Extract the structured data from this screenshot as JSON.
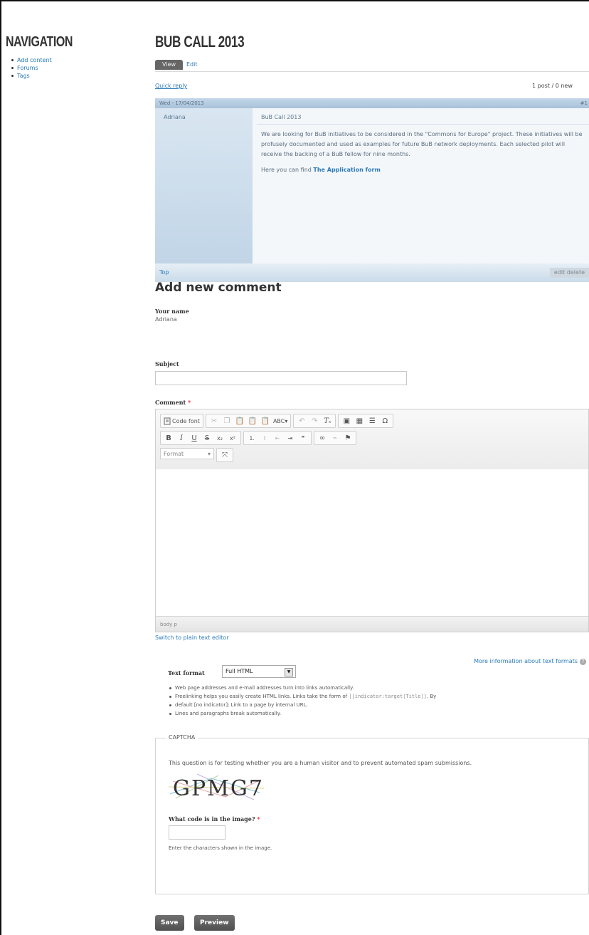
{
  "sidebar": {
    "title": "NAVIGATION",
    "items": [
      {
        "label": "Add content"
      },
      {
        "label": "Forums"
      },
      {
        "label": "Tags"
      }
    ]
  },
  "page": {
    "title": "BUB CALL 2013",
    "tabs": [
      {
        "label": "View"
      },
      {
        "label": "Edit"
      }
    ],
    "quick_reply": "Quick reply",
    "post_count": "1 post / 0 new"
  },
  "post": {
    "meta": "Wed - 17/04/2013",
    "number": "#1",
    "author": "Adriana",
    "subject": "BuB Call 2013",
    "body": "We are looking for BuB initiatives to be considered in the \"Commons for Europe\" project. These initiatives will be profusely documented and used as examples for future BuB network deployments. Each selected pilot will receive the backing of a BuB fellow for nine months.",
    "link_intro": "Here you can find ",
    "link_label": "The Application form",
    "top": "Top",
    "actions": "edit  delete"
  },
  "comment_form": {
    "heading": "Add new comment",
    "your_name_label": "Your name",
    "your_name_value": "Adriana",
    "subject_label": "Subject",
    "subject_value": "",
    "comment_label": "Comment",
    "required_mark": "*",
    "editor": {
      "source_label": "Code font",
      "format_label": "Format",
      "path": "body  p"
    },
    "switch_link": "Switch to plain text editor",
    "more_info": "More information about text formats",
    "text_format_label": "Text format",
    "text_format_value": "Full HTML",
    "tips": [
      "Web page addresses and e-mail addresses turn into links automatically.",
      "Freelinking helps you easily create HTML links. Links take the form of",
      "default [no indicator]: Link to a page by internal URL.",
      "Lines and paragraphs break automatically."
    ],
    "freelink_code": "[[indicator:target|Title]]",
    "freelink_tail": ". By"
  },
  "captcha": {
    "legend": "CAPTCHA",
    "description": "This question is for testing whether you are a human visitor and to prevent automated spam submissions.",
    "image_text": "GPMG7",
    "code_label": "What code is in the image?",
    "required_mark": "*",
    "code_value": "",
    "help": "Enter the characters shown in the image."
  },
  "buttons": {
    "save": "Save",
    "preview": "Preview"
  },
  "colors": {
    "link": "#2a7ab8",
    "button_bg": "#5e5e5e",
    "post_header": "#b4cadf",
    "required": "#e33333"
  }
}
